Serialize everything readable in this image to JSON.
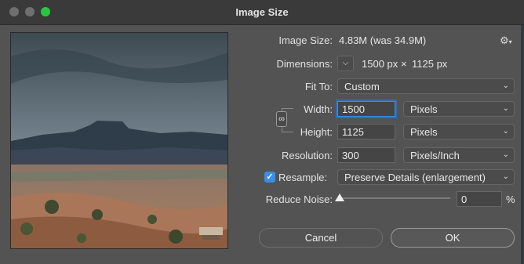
{
  "window": {
    "title": "Image Size"
  },
  "image_size": {
    "label": "Image Size:",
    "value": "4.83M (was 34.9M)"
  },
  "dimensions": {
    "label": "Dimensions:",
    "width": "1500 px",
    "times": "×",
    "height": "1125 px"
  },
  "fit_to": {
    "label": "Fit To:",
    "value": "Custom"
  },
  "width": {
    "label": "Width:",
    "value": "1500",
    "unit": "Pixels"
  },
  "height": {
    "label": "Height:",
    "value": "1125",
    "unit": "Pixels"
  },
  "resolution": {
    "label": "Resolution:",
    "value": "300",
    "unit": "Pixels/Inch"
  },
  "resample": {
    "label": "Resample:",
    "checked": true,
    "check_glyph": "✓",
    "value": "Preserve Details (enlargement)"
  },
  "reduce_noise": {
    "label": "Reduce Noise:",
    "value": "0",
    "unit": "%",
    "level": 0
  },
  "buttons": {
    "cancel": "Cancel",
    "ok": "OK"
  },
  "icons": {
    "gear": "gear-icon",
    "chevron": "chevron-down-icon",
    "link": "chain-link-icon",
    "close": "close-icon",
    "minimize": "minimize-icon",
    "zoom": "zoom-icon"
  },
  "colors": {
    "accent": "#3a8ee6",
    "zoom": "#27c840",
    "panel": "#535353"
  }
}
